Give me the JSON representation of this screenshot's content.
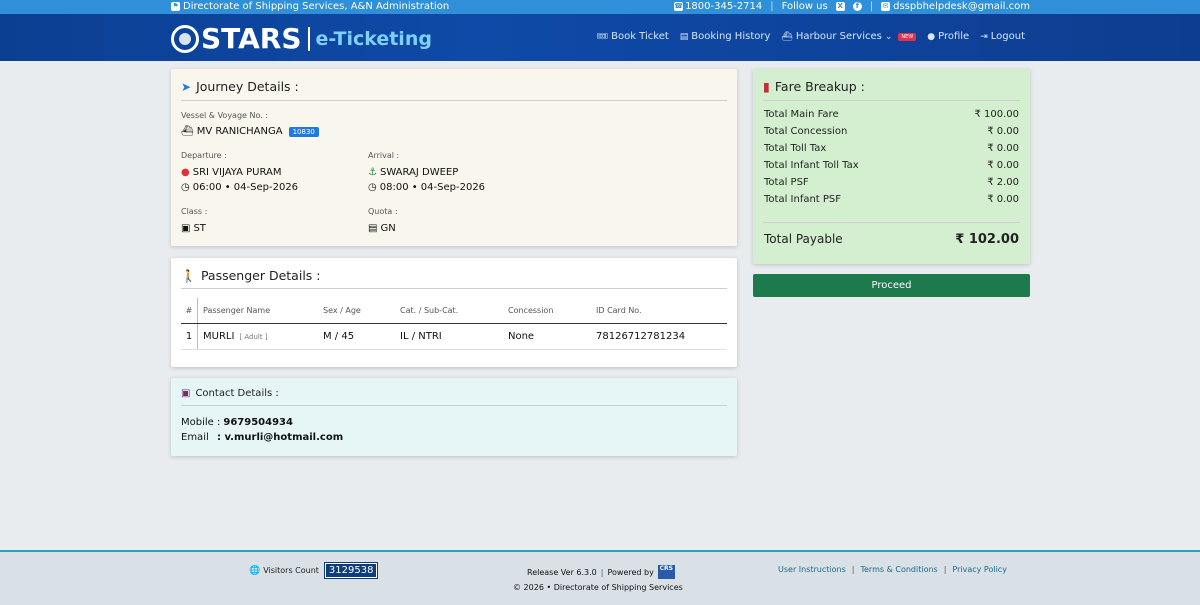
{
  "topbar": {
    "org": "Directorate of Shipping Services, A&N Administration",
    "phone": "1800-345-2714",
    "follow": "Follow us",
    "email": "dsspbhelpdesk@gmail.com"
  },
  "header": {
    "brand": "STARS",
    "subbrand": "e-Ticketing",
    "nav": [
      {
        "label": "Book Ticket"
      },
      {
        "label": "Booking History"
      },
      {
        "label": "Harbour Services",
        "badge": "NEW"
      },
      {
        "label": "Profile"
      },
      {
        "label": "Logout"
      }
    ]
  },
  "journey": {
    "title": "Journey Details :",
    "vessel_label": "Vessel & Voyage No. :",
    "vessel": "MV RANICHANGA",
    "voyage": "10830",
    "departure_label": "Departure :",
    "departure_place": "SRI VIJAYA PURAM",
    "departure_time": "06:00 • 04-Sep-2026",
    "arrival_label": "Arrival :",
    "arrival_place": "SWARAJ DWEEP",
    "arrival_time": "08:00 • 04-Sep-2026",
    "class_label": "Class :",
    "class": "ST",
    "quota_label": "Quota :",
    "quota": "GN"
  },
  "passenger": {
    "title": "Passenger Details :",
    "headers": [
      "#",
      "Passenger Name",
      "Sex / Age",
      "Cat. / Sub-Cat.",
      "Concession",
      "ID Card No."
    ],
    "rows": [
      {
        "n": "1",
        "name": "MURLI",
        "type": "[ Adult ]",
        "sexage": "M / 45",
        "cat": "IL / NTRI",
        "concession": "None",
        "id": "78126712781234"
      }
    ]
  },
  "contact": {
    "title": "Contact Details :",
    "mobile_label": "Mobile :",
    "mobile": "9679504934",
    "email_label": "Email",
    "email": ": v.murli@hotmail.com"
  },
  "fare": {
    "title": "Fare Breakup :",
    "rows": [
      {
        "label": "Total Main Fare",
        "value": "₹ 100.00"
      },
      {
        "label": "Total Concession",
        "value": "₹ 0.00"
      },
      {
        "label": "Total Toll Tax",
        "value": "₹ 0.00"
      },
      {
        "label": "Total Infant Toll Tax",
        "value": "₹ 0.00"
      },
      {
        "label": "Total PSF",
        "value": "₹ 2.00"
      },
      {
        "label": "Total Infant PSF",
        "value": "₹ 0.00"
      }
    ],
    "total_label": "Total Payable",
    "total_value": "₹ 102.00",
    "proceed": "Proceed"
  },
  "footer": {
    "visitors_label": "Visitors Count",
    "visitors": "3129538",
    "release": "Release Ver 6.3.0",
    "powered": "Powered by",
    "copyright": "© 2026 • Directorate of Shipping Services",
    "links": [
      "User Instructions",
      "Terms & Conditions",
      "Privacy Policy"
    ]
  },
  "colors": {
    "topbar": "#2f8fd8",
    "header": "#0f4aa8",
    "proceed": "#1d7a4c",
    "fare_bg": "#d3efcf"
  }
}
